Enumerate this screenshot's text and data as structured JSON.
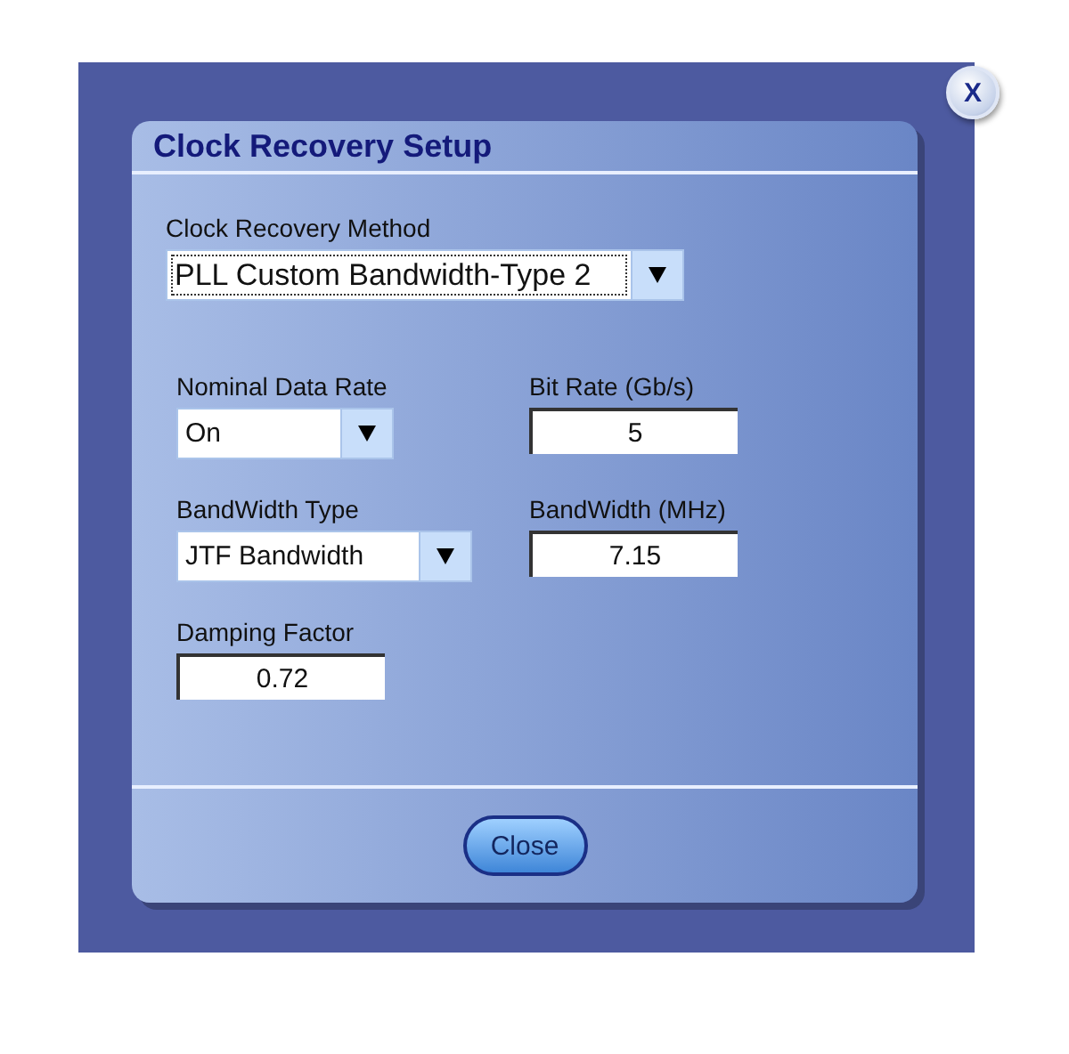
{
  "window": {
    "close_button": "X"
  },
  "dialog": {
    "title": "Clock Recovery Setup",
    "method": {
      "label": "Clock Recovery Method",
      "kind": "dropdown",
      "value": "PLL Custom Bandwidth-Type 2",
      "focused": true
    },
    "fields": [
      {
        "label": "Nominal Data Rate",
        "kind": "dropdown",
        "value": "On",
        "focused": false
      },
      {
        "label": "Bit Rate (Gb/s)",
        "kind": "input",
        "value": "5",
        "focused": false
      },
      {
        "label": "BandWidth Type",
        "kind": "dropdown",
        "value": "JTF Bandwidth",
        "focused": false
      },
      {
        "label": "BandWidth (MHz)",
        "kind": "input",
        "value": "7.15",
        "focused": false
      },
      {
        "label": "Damping Factor",
        "kind": "input",
        "value": "0.72",
        "focused": false
      }
    ],
    "buttons": [
      "Close"
    ]
  }
}
